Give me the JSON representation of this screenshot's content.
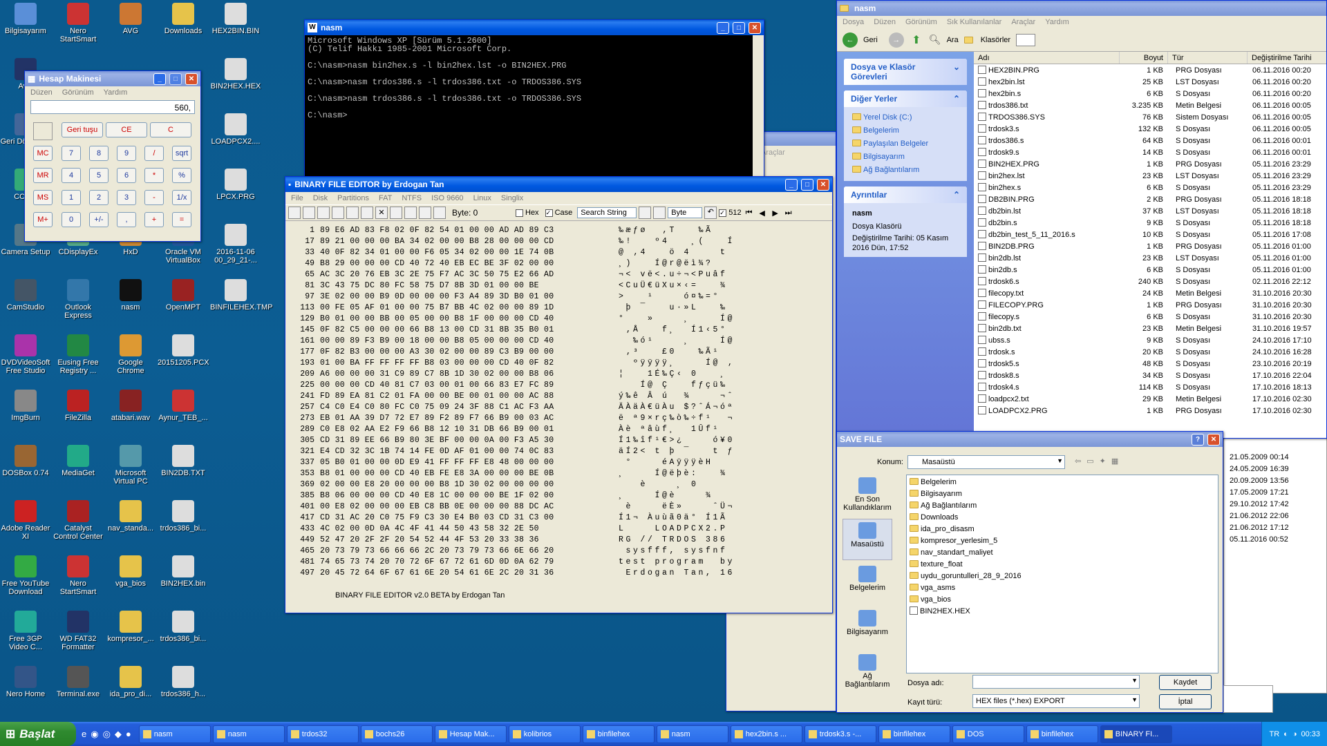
{
  "desktop": {
    "icons": [
      {
        "label": "Bilgisayarım",
        "c": "#5a8fd8"
      },
      {
        "label": "Nero StartSmart",
        "c": "#c33"
      },
      {
        "label": "AVG",
        "c": "#c73"
      },
      {
        "label": "Downloads",
        "c": "#e6c34a"
      },
      {
        "label": "HEX2BIN.BIN",
        "c": "#ddd"
      },
      {
        "label": "Av...",
        "c": "#236"
      },
      {
        "label": "BIN2HEX.HEX",
        "c": "#ddd"
      },
      {
        "label": "Geri Dö... Ku...",
        "c": "#469"
      },
      {
        "label": "LOADPCX2....",
        "c": "#ddd"
      },
      {
        "label": "CCle...",
        "c": "#3a7"
      },
      {
        "label": "LPCX.PRG",
        "c": "#ddd"
      },
      {
        "label": "Camera Setup",
        "c": "#578"
      },
      {
        "label": "CDisplayEx",
        "c": "#5a8"
      },
      {
        "label": "HxD",
        "c": "#c83"
      },
      {
        "label": "Oracle VM VirtualBox",
        "c": "#259"
      },
      {
        "label": "2016-11-06 00_29_21-...",
        "c": "#ddd"
      },
      {
        "label": "CamStudio",
        "c": "#456"
      },
      {
        "label": "Outlook Express",
        "c": "#37a"
      },
      {
        "label": "nasm",
        "c": "#111"
      },
      {
        "label": "OpenMPT",
        "c": "#922"
      },
      {
        "label": "BINFILEHEX.TMP",
        "c": "#ddd"
      },
      {
        "label": "DVDVideoSoft Free Studio",
        "c": "#a3a"
      },
      {
        "label": "Eusing Free Registry ...",
        "c": "#284"
      },
      {
        "label": "Google Chrome",
        "c": "#d93"
      },
      {
        "label": "20151205.PCX",
        "c": "#ddd"
      },
      {
        "label": "ImgBurn",
        "c": "#888"
      },
      {
        "label": "FileZilla",
        "c": "#b22"
      },
      {
        "label": "atabari.wav",
        "c": "#822"
      },
      {
        "label": "Aynur_TEB_...",
        "c": "#c33"
      },
      {
        "label": "DOSBox 0.74",
        "c": "#963"
      },
      {
        "label": "MediaGet",
        "c": "#2a8"
      },
      {
        "label": "Microsoft Virtual PC",
        "c": "#59a"
      },
      {
        "label": "BIN2DB.TXT",
        "c": "#ddd"
      },
      {
        "label": "Adobe Reader XI",
        "c": "#c22"
      },
      {
        "label": "Catalyst Control Center",
        "c": "#a22"
      },
      {
        "label": "nav_standa...",
        "c": "#e6c34a"
      },
      {
        "label": "trdos386_bi...",
        "c": "#ddd"
      },
      {
        "label": "Free YouTube Download",
        "c": "#3a4"
      },
      {
        "label": "Nero StartSmart",
        "c": "#c33"
      },
      {
        "label": "vga_bios",
        "c": "#e6c34a"
      },
      {
        "label": "BIN2HEX.bin",
        "c": "#ddd"
      },
      {
        "label": "Free 3GP Video C...",
        "c": "#2a9"
      },
      {
        "label": "WD FAT32 Formatter",
        "c": "#236"
      },
      {
        "label": "kompresor_...",
        "c": "#e6c34a"
      },
      {
        "label": "trdos386_bi...",
        "c": "#ddd"
      },
      {
        "label": "Nero Home",
        "c": "#358"
      },
      {
        "label": "Terminal.exe",
        "c": "#555"
      },
      {
        "label": "ida_pro_di...",
        "c": "#e6c34a"
      },
      {
        "label": "trdos386_h...",
        "c": "#ddd"
      }
    ]
  },
  "cmd": {
    "title": "nasm",
    "lines": [
      "Microsoft Windows XP [Sürüm 5.1.2600]",
      "(C) Telif Hakkı 1985-2001 Microsoft Corp.",
      "",
      "C:\\nasm>nasm bin2hex.s -l bin2hex.lst -o BIN2HEX.PRG",
      "",
      "C:\\nasm>nasm trdos386.s -l trdos386.txt -o TRDOS386.SYS",
      "",
      "C:\\nasm>nasm trdos386.s -l trdos386.txt -o TRDOS386.SYS",
      "",
      "C:\\nasm>"
    ]
  },
  "calc": {
    "title": "Hesap Makinesi",
    "menu": [
      "Düzen",
      "Görünüm",
      "Yardım"
    ],
    "display": "560,",
    "row0": [
      "Geri tuşu",
      "CE",
      "C"
    ],
    "rows": [
      [
        "MC",
        "7",
        "8",
        "9",
        "/",
        "sqrt"
      ],
      [
        "MR",
        "4",
        "5",
        "6",
        "*",
        "%"
      ],
      [
        "MS",
        "1",
        "2",
        "3",
        "-",
        "1/x"
      ],
      [
        "M+",
        "0",
        "+/-",
        ",",
        "+",
        "="
      ]
    ]
  },
  "hexeditor": {
    "title": "BINARY FILE EDITOR by Erdogan Tan",
    "menu": [
      "File",
      "Disk",
      "Partitions",
      "FAT",
      "NTFS",
      "ISO 9660",
      "Linux",
      "Singlix"
    ],
    "byte_label": "Byte: 0",
    "hex_label": "Hex",
    "case_label": "Case",
    "search_label": "Search String",
    "mode_label": "Byte",
    "count_label": "512",
    "footer": "BINARY FILE EDITOR v2.0 BETA by Erdogan Tan",
    "rows": [
      {
        "o": "1",
        "h": "89 E6 AD 83 F8 02 0F 82 54 01 00 00 AD AD 89 C3",
        "a": "‰æ­ƒø  ‚T   ­­‰Ã"
      },
      {
        "o": "17",
        "h": "89 21 00 00 00 BA 34 02 00 00 B8 28 00 00 00 CD",
        "a": "‰!   º4   ¸(   Í"
      },
      {
        "o": "33",
        "h": "40 0F 82 34 01 00 00 F6 05 34 02 00 00 1E 74 0B",
        "a": "@ ‚4   ö 4    t "
      },
      {
        "o": "49",
        "h": "B8 29 00 00 00 CD 40 72 40 EB EC BE 3F 02 00 00",
        "a": "¸)   Í@r@ëì¾?   "
      },
      {
        "o": "65",
        "h": "AC 3C 20 76 EB 3C 2E 75 F7 AC 3C 50 75 E2 66 AD",
        "a": "¬< vë<.u÷¬<Puâf­"
      },
      {
        "o": "81",
        "h": "3C 43 75 DC 80 FC 58 75 D7 8B 3D 01 00 00 BE",
        "a": "<CuÜ€üXu×‹=   ¾"
      },
      {
        "o": "97",
        "h": "3E 02 00 00 B9 0D 00 00 00 F3 A4 89 3D B0 01 00",
        "a": ">   ¹    ó¤‰=°  "
      },
      {
        "o": "113",
        "h": "00 FE 05 AF 01 00 00 75 B7 BB 4C 02 00 00 89 1D",
        "a": " þ ¯   u·»L   ‰ "
      },
      {
        "o": "129",
        "h": "B0 01 00 00 BB 00 05 00 00 B8 1F 00 00 00 CD 40",
        "a": "°   »    ¸    Í@"
      },
      {
        "o": "145",
        "h": "0F 82 C5 00 00 00 66 B8 13 00 CD 31 8B 35 B0 01",
        "a": " ‚Å   f¸  Í1‹5° "
      },
      {
        "o": "161",
        "h": "00 00 89 F3 B9 00 18 00 00 B8 05 00 00 00 CD 40",
        "a": "  ‰ó¹    ¸    Í@"
      },
      {
        "o": "177",
        "h": "0F 82 B3 00 00 00 A3 30 02 00 00 89 C3 B9 00 00",
        "a": " ‚³   £0   ‰Ã¹  "
      },
      {
        "o": "193",
        "h": "01 00 BA FF FF FF FF B8 03 00 00 00 CD 40 0F 82",
        "a": "  ºÿÿÿÿ¸    Í@ ‚"
      },
      {
        "o": "209",
        "h": "A6 00 00 00 31 C9 89 C7 8B 1D 30 02 00 00 B8 06",
        "a": "¦   1É‰Ç‹ 0   ¸ "
      },
      {
        "o": "225",
        "h": "00 00 00 CD 40 81 C7 03 00 01 00 66 83 E7 FC 89",
        "a": "   Í@ Ç   fƒçü‰"
      },
      {
        "o": "241",
        "h": "FD 89 EA 81 C2 01 FA 00 00 BE 00 01 00 00 AC 88",
        "a": "ý‰ê Â ú  ¾    ¬ˆ"
      },
      {
        "o": "257",
        "h": "C4 C0 E4 C0 80 FC C0 75 09 24 3F 88 C1 AC F3 AA",
        "a": "ÄÀäÀ€üÀu $?ˆÁ¬óª"
      },
      {
        "o": "273",
        "h": "EB 01 AA 39 D7 72 E7 89 F2 89 F7 66 B9 00 03 AC",
        "a": "ë ª9×rç‰ò‰÷f¹  ¬"
      },
      {
        "o": "289",
        "h": "C0 E8 02 AA E2 F9 66 B8 12 10 31 DB 66 B9 00 01",
        "a": "Àè ªâùf¸  1Ûf¹  "
      },
      {
        "o": "305",
        "h": "CD 31 89 EE 66 B9 80 3E BF 00 00 0A 00 F3 A5 30",
        "a": "Í1‰îf¹€>¿    ó¥0"
      },
      {
        "o": "321",
        "h": "E4 CD 32 3C 1B 74 14 FE 0D AF 01 00 00 74 0C 83",
        "a": "äÍ2< t þ ¯   t ƒ"
      },
      {
        "o": "337",
        "h": "05 B0 01 00 00 0D E9 41 FF FF FF E8 48 00 00 00",
        "a": " °    éAÿÿÿèH   "
      },
      {
        "o": "353",
        "h": "B8 01 00 00 00 CD 40 EB FE E8 3A 00 00 00 BE 0B",
        "a": "¸    Í@ëþè:   ¾ "
      },
      {
        "o": "369",
        "h": "02 00 00 E8 20 00 00 00 B8 1D 30 02 00 00 00 00",
        "a": "   è    ¸ 0     "
      },
      {
        "o": "385",
        "h": "B8 06 00 00 00 CD 40 E8 1C 00 00 00 BE 1F 02 00",
        "a": "¸    Í@è    ¾   "
      },
      {
        "o": "401",
        "h": "00 E8 02 00 00 00 EB C8 BB 0E 00 00 00 88 DC AC",
        "a": " è    ëÈ»    ˆÜ¬"
      },
      {
        "o": "417",
        "h": "CD 31 AC 20 C0 75 F9 C3 30 E4 B0 03 CD 31 C3 00",
        "a": "Í1¬ Àuùã0ä° Í1Ã "
      },
      {
        "o": "433",
        "h": "4C 02 00 0D 0A 4C 4F 41 44 50 43 58 32 2E 50",
        "a": "L    LOADPCX2.P"
      },
      {
        "o": "449",
        "h": "52 47 20 2F 2F 20 54 52 44 4F 53 20 33 38 36",
        "a": "RG // TRDOS 386"
      },
      {
        "o": "465",
        "h": "20 73 79 73 66 66 66 2C 20 73 79 73 66 6E 66 20",
        "a": " sysfff, sysfnf "
      },
      {
        "o": "481",
        "h": "74 65 73 74 20 70 72 6F 67 72 61 6D 0D 0A 62 79",
        "a": "test program  by"
      },
      {
        "o": "497",
        "h": "20 45 72 64 6F 67 61 6E 20 54 61 6E 2C 20 31 36",
        "a": " Erdogan Tan, 16"
      }
    ]
  },
  "explorer": {
    "title": "nasm",
    "menu": [
      "Dosya",
      "Düzen",
      "Görünüm",
      "Sık Kullanılanlar",
      "Araçlar",
      "Yardım"
    ],
    "back": "Geri",
    "search": "Ara",
    "folders": "Klasörler",
    "tasks_title": "Dosya ve Klasör Görevleri",
    "places_title": "Diğer Yerler",
    "places": [
      "Yerel Disk (C:)",
      "Belgelerim",
      "Paylaşılan Belgeler",
      "Bilgisayarım",
      "Ağ Bağlantılarım"
    ],
    "details_title": "Ayrıntılar",
    "details_name": "nasm",
    "details_type": "Dosya Klasörü",
    "details_date": "Değiştirilme Tarihi: 05 Kasım 2016 Dün, 17:52",
    "cols": [
      "Adı",
      "Boyut",
      "Tür",
      "Değiştirilme Tarihi"
    ],
    "files": [
      [
        "HEX2BIN.PRG",
        "1 KB",
        "PRG Dosyası",
        "06.11.2016 00:20"
      ],
      [
        "hex2bin.lst",
        "25 KB",
        "LST Dosyası",
        "06.11.2016 00:20"
      ],
      [
        "hex2bin.s",
        "6 KB",
        "S Dosyası",
        "06.11.2016 00:20"
      ],
      [
        "trdos386.txt",
        "3.235 KB",
        "Metin Belgesi",
        "06.11.2016 00:05"
      ],
      [
        "TRDOS386.SYS",
        "76 KB",
        "Sistem Dosyası",
        "06.11.2016 00:05"
      ],
      [
        "trdosk3.s",
        "132 KB",
        "S Dosyası",
        "06.11.2016 00:05"
      ],
      [
        "trdos386.s",
        "64 KB",
        "S Dosyası",
        "06.11.2016 00:01"
      ],
      [
        "trdosk9.s",
        "14 KB",
        "S Dosyası",
        "06.11.2016 00:01"
      ],
      [
        "BIN2HEX.PRG",
        "1 KB",
        "PRG Dosyası",
        "05.11.2016 23:29"
      ],
      [
        "bin2hex.lst",
        "23 KB",
        "LST Dosyası",
        "05.11.2016 23:29"
      ],
      [
        "bin2hex.s",
        "6 KB",
        "S Dosyası",
        "05.11.2016 23:29"
      ],
      [
        "DB2BIN.PRG",
        "2 KB",
        "PRG Dosyası",
        "05.11.2016 18:18"
      ],
      [
        "db2bin.lst",
        "37 KB",
        "LST Dosyası",
        "05.11.2016 18:18"
      ],
      [
        "db2bin.s",
        "9 KB",
        "S Dosyası",
        "05.11.2016 18:18"
      ],
      [
        "db2bin_test_5_11_2016.s",
        "10 KB",
        "S Dosyası",
        "05.11.2016 17:08"
      ],
      [
        "BIN2DB.PRG",
        "1 KB",
        "PRG Dosyası",
        "05.11.2016 01:00"
      ],
      [
        "bin2db.lst",
        "23 KB",
        "LST Dosyası",
        "05.11.2016 01:00"
      ],
      [
        "bin2db.s",
        "6 KB",
        "S Dosyası",
        "05.11.2016 01:00"
      ],
      [
        "trdosk6.s",
        "240 KB",
        "S Dosyası",
        "02.11.2016 22:12"
      ],
      [
        "filecopy.txt",
        "24 KB",
        "Metin Belgesi",
        "31.10.2016 20:30"
      ],
      [
        "FILECOPY.PRG",
        "1 KB",
        "PRG Dosyası",
        "31.10.2016 20:30"
      ],
      [
        "filecopy.s",
        "6 KB",
        "S Dosyası",
        "31.10.2016 20:30"
      ],
      [
        "bin2db.txt",
        "23 KB",
        "Metin Belgesi",
        "31.10.2016 19:57"
      ],
      [
        "ubss.s",
        "9 KB",
        "S Dosyası",
        "24.10.2016 17:10"
      ],
      [
        "trdosk.s",
        "20 KB",
        "S Dosyası",
        "24.10.2016 16:28"
      ],
      [
        "trdosk5.s",
        "48 KB",
        "S Dosyası",
        "23.10.2016 20:19"
      ],
      [
        "trdosk8.s",
        "34 KB",
        "S Dosyası",
        "17.10.2016 22:04"
      ],
      [
        "trdosk4.s",
        "114 KB",
        "S Dosyası",
        "17.10.2016 18:13"
      ],
      [
        "loadpcx2.txt",
        "29 KB",
        "Metin Belgesi",
        "17.10.2016 02:30"
      ],
      [
        "LOADPCX2.PRG",
        "1 KB",
        "PRG Dosyası",
        "17.10.2016 02:30"
      ]
    ]
  },
  "behind": {
    "dates": [
      "21.05.2009 00:14",
      "24.05.2009 16:39",
      "20.09.2009 13:56",
      "17.05.2009 17:21",
      "29.10.2012 17:42",
      "21.06.2012 22:06",
      "21.06.2012 17:12",
      "05.11.2016 00:52"
    ],
    "frag1": "masa",
    "frag2": "Belg...",
    "ara": "Araçlar"
  },
  "save": {
    "title": "SAVE FILE",
    "konum_label": "Konum:",
    "konum": "Masaüstü",
    "places": [
      "En Son Kullandıklarım",
      "Masaüstü",
      "Belgelerim",
      "Bilgisayarım",
      "Ağ Bağlantılarım"
    ],
    "items": [
      "Belgelerim",
      "Bilgisayarım",
      "Ağ Bağlantılarım",
      "Downloads",
      "ida_pro_disasm",
      "kompresor_yerlesim_5",
      "nav_standart_maliyet",
      "texture_float",
      "uydu_goruntulleri_28_9_2016",
      "vga_asms",
      "vga_bios",
      "BIN2HEX.HEX"
    ],
    "name_label": "Dosya adı:",
    "name_value": "",
    "type_label": "Kayıt türü:",
    "type_value": "HEX files (*.hex) EXPORT",
    "save_btn": "Kaydet",
    "cancel_btn": "İptal"
  },
  "taskbar": {
    "start": "Başlat",
    "buttons": [
      "nasm",
      "nasm",
      "trdos32",
      "bochs26",
      "Hesap Mak...",
      "kolibrios",
      "binfilehex",
      "nasm",
      "hex2bin.s ...",
      "trdosk3.s -...",
      "binfilehex",
      "DOS",
      "binfilehex",
      "BINARY FI..."
    ],
    "lang": "TR",
    "clock": "00:33"
  }
}
